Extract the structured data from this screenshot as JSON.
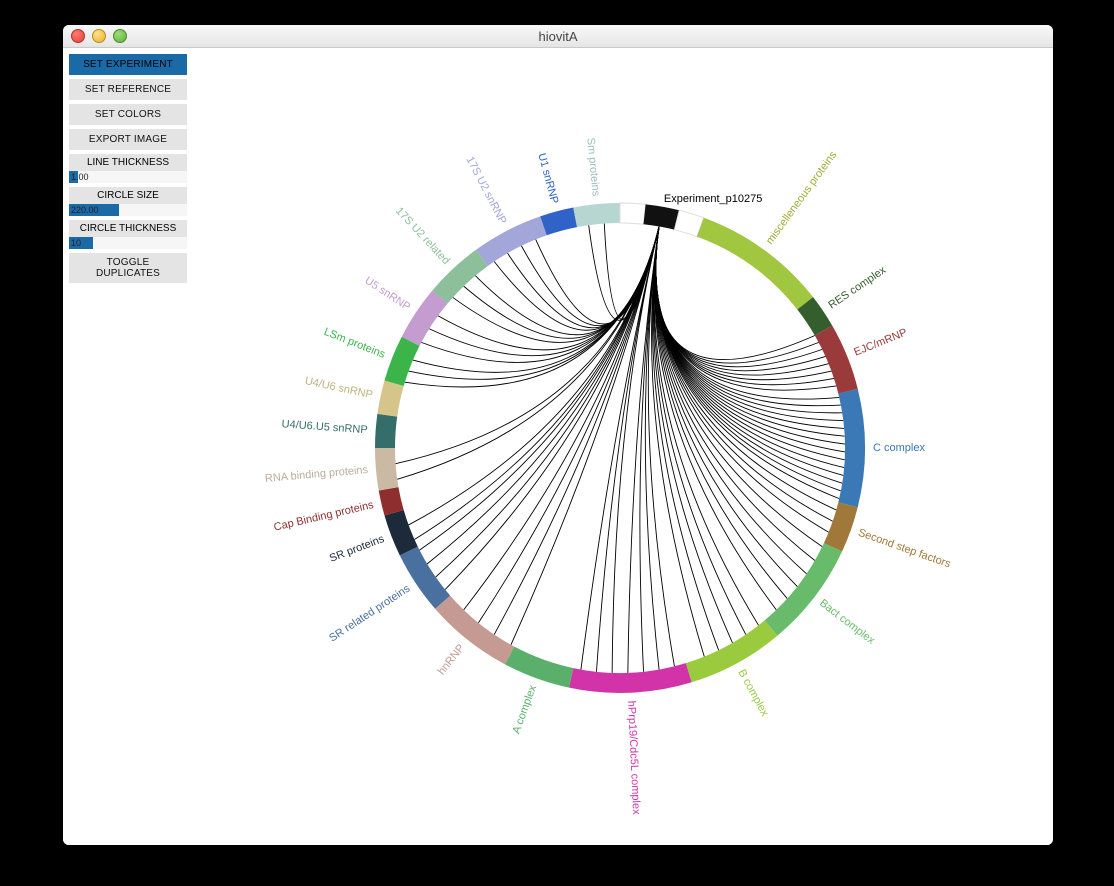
{
  "window": {
    "title": "hiovitA"
  },
  "sidebar": {
    "set_experiment": "SET EXPERIMENT",
    "set_reference": "SET REFERENCE",
    "set_colors": "SET COLORS",
    "export_image": "EXPORT IMAGE",
    "line_thickness_label": "LINE THICKNESS",
    "line_thickness_value": "1.00",
    "circle_size_label": "CIRCLE SIZE",
    "circle_size_value": "220.00",
    "circle_thickness_label": "CIRCLE THICKNESS",
    "circle_thickness_value": "10",
    "toggle_duplicates": "TOGGLE DUPLICATES"
  },
  "chart_data": {
    "type": "radial-segment",
    "radius_outer": 245,
    "radius_inner": 225,
    "center_label": "Experiment_p10275",
    "segments": [
      {
        "name": "C complex",
        "start": 76,
        "end": 104,
        "color": "#3a78b6",
        "label_color": "#3a78b6"
      },
      {
        "name": "Second step factors",
        "start": 104,
        "end": 115,
        "color": "#a07839",
        "label_color": "#a07839"
      },
      {
        "name": "Bact complex",
        "start": 115,
        "end": 140,
        "color": "#67bb6a",
        "label_color": "#67bb6a"
      },
      {
        "name": "B complex",
        "start": 140,
        "end": 163,
        "color": "#9acb3f",
        "label_color": "#9acb3f"
      },
      {
        "name": "hPrp19/Cdc5L complex",
        "start": 163,
        "end": 192,
        "color": "#d233a9",
        "label_color": "#d233a9"
      },
      {
        "name": "A complex",
        "start": 192,
        "end": 208,
        "color": "#5ab06a",
        "label_color": "#5ab06a"
      },
      {
        "name": "hnRNP",
        "start": 208,
        "end": 229,
        "color": "#c49a92",
        "label_color": "#c49a92"
      },
      {
        "name": "SR related proteins",
        "start": 229,
        "end": 244,
        "color": "#4a70a0",
        "label_color": "#4a70a0"
      },
      {
        "name": "SR proteins",
        "start": 244,
        "end": 254,
        "color": "#1c2a3b",
        "label_color": "#1c2a3b"
      },
      {
        "name": "Cap Binding proteins",
        "start": 254,
        "end": 260,
        "color": "#8f2e2e",
        "label_color": "#8f2e2e"
      },
      {
        "name": "RNA binding proteins",
        "start": 260,
        "end": 270,
        "color": "#cab9a3",
        "label_color": "#b9ad9a"
      },
      {
        "name": "U4/U6.U5 snRNP",
        "start": 270,
        "end": 278,
        "color": "#356d6b",
        "label_color": "#356d6b"
      },
      {
        "name": "U4/U6 snRNP",
        "start": 278,
        "end": 286,
        "color": "#d5c58b",
        "label_color": "#c1b37f"
      },
      {
        "name": "LSm proteins",
        "start": 286,
        "end": 297,
        "color": "#3bb54a",
        "label_color": "#3bb54a"
      },
      {
        "name": "U5 snRNP",
        "start": 297,
        "end": 310,
        "color": "#c49cd0",
        "label_color": "#c49cd0"
      },
      {
        "name": "17S U2 related",
        "start": 310,
        "end": 324,
        "color": "#8cbf9a",
        "label_color": "#8cbf9a"
      },
      {
        "name": "17S U2 snRNP",
        "start": 324,
        "end": 341,
        "color": "#a3a6d9",
        "label_color": "#a3a6d9"
      },
      {
        "name": "U1 snRNP",
        "start": 341,
        "end": 349,
        "color": "#3162c7",
        "label_color": "#3162c7"
      },
      {
        "name": "Sm proteins",
        "start": 349,
        "end": 360,
        "color": "#b7d5d1",
        "label_color": "#9cbfba"
      },
      {
        "name": "_gap1",
        "start": 360,
        "end": 366,
        "color": "#ffffff",
        "label_color": "#000000",
        "hidden": true
      },
      {
        "name": "Experiment_p10275",
        "start": 366,
        "end": 374,
        "color": "#111111",
        "label_color": "#000000",
        "is_hub": true
      },
      {
        "name": "_gap2",
        "start": 374,
        "end": 380,
        "color": "#ffffff",
        "label_color": "#000000",
        "hidden": true
      },
      {
        "name": "miscelleneous proteins",
        "start": 20,
        "end": 52,
        "color": "#a1c640",
        "label_color": "#a1ab3b"
      },
      {
        "name": "RES complex",
        "start": 52,
        "end": 60,
        "color": "#355e2e",
        "label_color": "#355e2e"
      },
      {
        "name": "EJC/mRNP",
        "start": 60,
        "end": 76,
        "color": "#9b3a3a",
        "label_color": "#9b3a3a"
      }
    ],
    "chord_sources": [
      60,
      62,
      64,
      66,
      68,
      70,
      72,
      74,
      77,
      79,
      81,
      83,
      85,
      87,
      89,
      91,
      93,
      95,
      97,
      99,
      101,
      103,
      106,
      109,
      112,
      116,
      120,
      124,
      128,
      132,
      136,
      142,
      146,
      150,
      154,
      158,
      166,
      170,
      174,
      178,
      182,
      186,
      190,
      209,
      214,
      219,
      224,
      231,
      235,
      239,
      243,
      246,
      250,
      262,
      266,
      287,
      290,
      293,
      298,
      302,
      306,
      312,
      316,
      320,
      326,
      330,
      334,
      338,
      352,
      356
    ],
    "hub_angle": 10
  }
}
